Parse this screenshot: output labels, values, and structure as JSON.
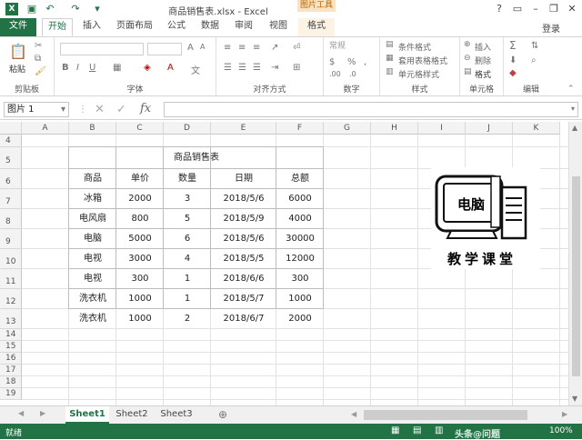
{
  "titlebar": {
    "title": "商品销售表.xlsx - Excel",
    "context_tools": "图片工具"
  },
  "tabs": [
    "文件",
    "开始",
    "插入",
    "页面布局",
    "公式",
    "数据",
    "审阅",
    "视图",
    "格式"
  ],
  "login": "登录",
  "ribbon": {
    "paste": "粘贴",
    "groups": [
      "剪贴板",
      "字体",
      "对齐方式",
      "数字",
      "样式",
      "单元格",
      "编辑"
    ],
    "number_format": "常规",
    "styles": [
      "条件格式",
      "套用表格格式",
      "单元格样式"
    ],
    "cells": [
      "插入",
      "删除",
      "格式"
    ]
  },
  "formula_bar": {
    "name_box": "图片 1",
    "fx": "fx",
    "value": ""
  },
  "columns": [
    "A",
    "B",
    "C",
    "D",
    "E",
    "F",
    "G",
    "H",
    "I",
    "J",
    "K"
  ],
  "rows": [
    "4",
    "5",
    "6",
    "7",
    "8",
    "9",
    "10",
    "11",
    "12",
    "13",
    "14",
    "15",
    "16",
    "17",
    "18",
    "19"
  ],
  "table": {
    "title": "商品销售表",
    "headers": [
      "商品",
      "单价",
      "数量",
      "日期",
      "总额"
    ],
    "rows": [
      [
        "冰箱",
        "2000",
        "3",
        "2018/5/6",
        "6000"
      ],
      [
        "电风扇",
        "800",
        "5",
        "2018/5/9",
        "4000"
      ],
      [
        "电脑",
        "5000",
        "6",
        "2018/5/6",
        "30000"
      ],
      [
        "电视",
        "3000",
        "4",
        "2018/5/5",
        "12000"
      ],
      [
        "电视",
        "300",
        "1",
        "2018/6/6",
        "300"
      ],
      [
        "洗衣机",
        "1000",
        "1",
        "2018/5/7",
        "1000"
      ],
      [
        "洗衣机",
        "1000",
        "2",
        "2018/6/7",
        "2000"
      ]
    ]
  },
  "picture": {
    "screen_text": "电脑",
    "caption": "教学课堂"
  },
  "sheets": [
    "Sheet1",
    "Sheet2",
    "Sheet3"
  ],
  "status": {
    "ready": "就绪",
    "zoom": "100%"
  },
  "watermark": "头条@问题"
}
